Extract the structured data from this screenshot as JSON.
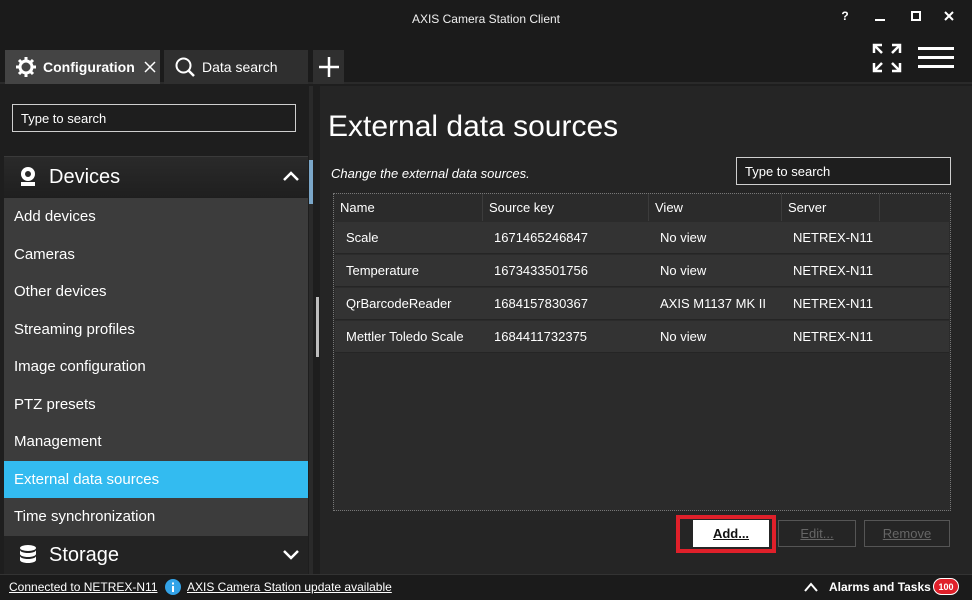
{
  "window": {
    "title": "AXIS Camera Station Client",
    "help_label": "?"
  },
  "tabs": [
    {
      "label": "Configuration"
    },
    {
      "label": "Data search"
    }
  ],
  "sidebar": {
    "search_placeholder": "Type to search",
    "devices_label": "Devices",
    "items": [
      {
        "label": "Add devices"
      },
      {
        "label": "Cameras"
      },
      {
        "label": "Other devices"
      },
      {
        "label": "Streaming profiles"
      },
      {
        "label": "Image configuration"
      },
      {
        "label": "PTZ presets"
      },
      {
        "label": "Management"
      },
      {
        "label": "External data sources"
      },
      {
        "label": "Time synchronization"
      }
    ],
    "active_item": "External data sources",
    "storage_label": "Storage"
  },
  "main": {
    "title": "External data sources",
    "description": "Change the external data sources.",
    "search_placeholder": "Type to search",
    "columns": [
      "Name",
      "Source key",
      "View",
      "Server"
    ],
    "rows": [
      {
        "name": "Scale",
        "source_key": "1671465246847",
        "view": "No view",
        "server": "NETREX-N11"
      },
      {
        "name": "Temperature",
        "source_key": "1673433501756",
        "view": "No view",
        "server": "NETREX-N11"
      },
      {
        "name": "QrBarcodeReader",
        "source_key": "1684157830367",
        "view": "AXIS M1137 MK II",
        "server": "NETREX-N11"
      },
      {
        "name": "Mettler Toledo Scale",
        "source_key": "1684411732375",
        "view": "No view",
        "server": "NETREX-N11"
      }
    ],
    "buttons": {
      "add": "Add...",
      "edit": "Edit...",
      "remove": "Remove"
    }
  },
  "statusbar": {
    "connection": "Connected to NETREX-N11",
    "update": "AXIS Camera Station update available",
    "alarms_label": "Alarms and Tasks",
    "alarm_count": "100"
  },
  "colors": {
    "accent": "#33bbf0",
    "highlight": "#e0202a",
    "badge": "#e0202a"
  }
}
